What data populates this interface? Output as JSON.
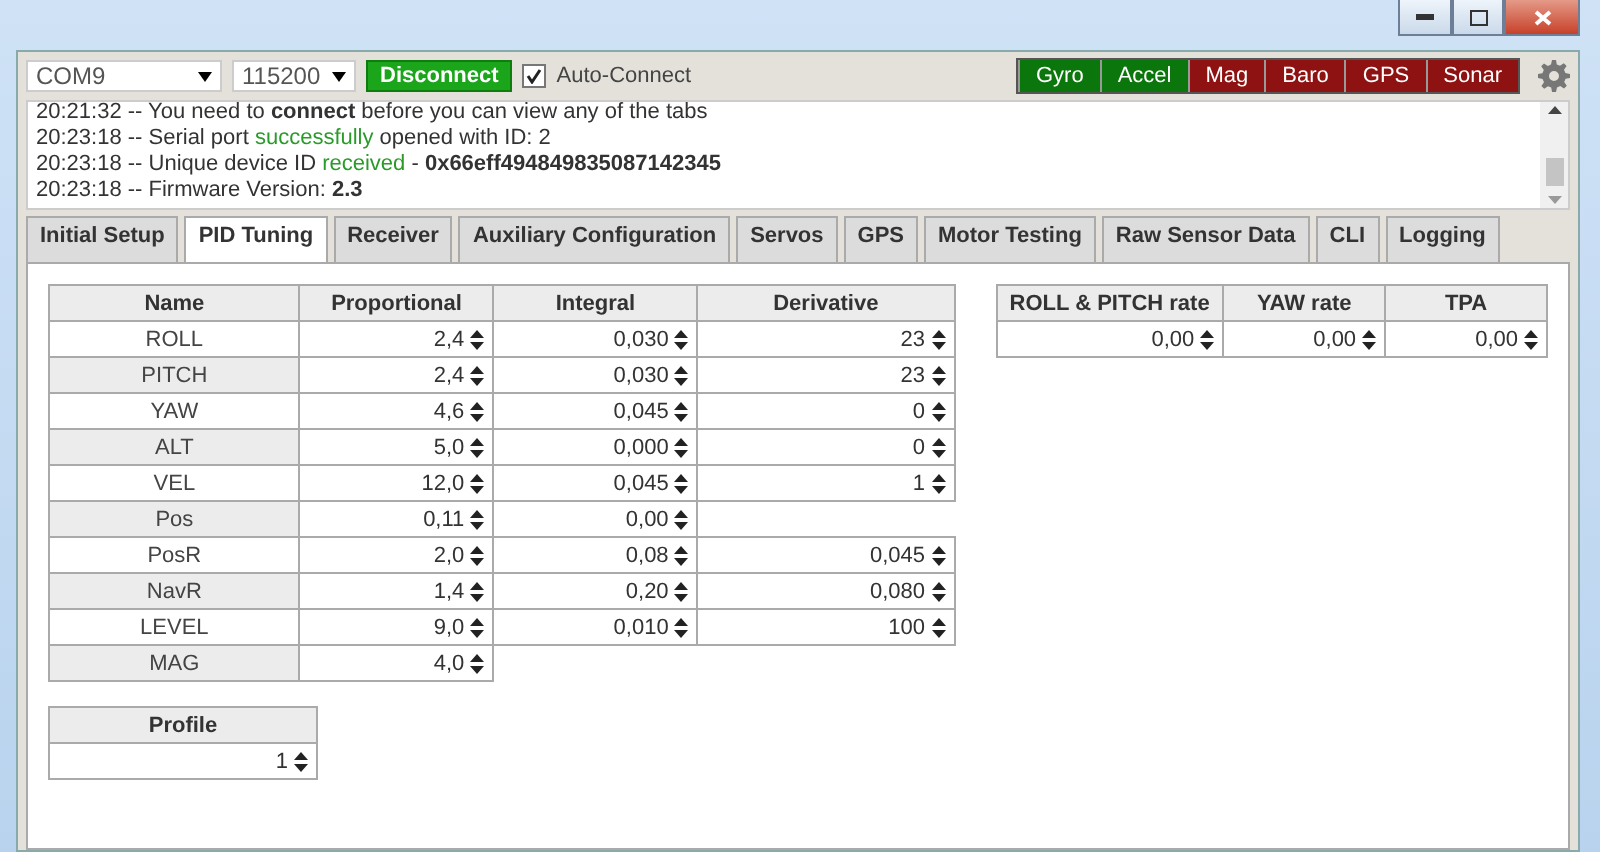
{
  "toolbar": {
    "port": "COM9",
    "baud": "115200",
    "connect_button": "Disconnect",
    "auto_connect": {
      "label": "Auto-Connect",
      "checked": true
    },
    "sensors": [
      {
        "label": "Gyro",
        "on": true
      },
      {
        "label": "Accel",
        "on": true
      },
      {
        "label": "Mag",
        "on": false
      },
      {
        "label": "Baro",
        "on": false
      },
      {
        "label": "GPS",
        "on": false
      },
      {
        "label": "Sonar",
        "on": false
      }
    ]
  },
  "log": [
    [
      {
        "text": "20:21:32 -- You need to ",
        "kind": "plain"
      },
      {
        "text": "connect",
        "kind": "bold"
      },
      {
        "text": " before you can view any of the tabs",
        "kind": "plain"
      }
    ],
    [
      {
        "text": "20:23:18 -- Serial port ",
        "kind": "plain"
      },
      {
        "text": "successfully",
        "kind": "green"
      },
      {
        "text": " opened with ID: 2",
        "kind": "plain"
      }
    ],
    [
      {
        "text": "20:23:18 -- Unique device ID ",
        "kind": "plain"
      },
      {
        "text": "received",
        "kind": "green"
      },
      {
        "text": " - ",
        "kind": "plain"
      },
      {
        "text": "0x66eff494849835087142345",
        "kind": "bold"
      }
    ],
    [
      {
        "text": "20:23:18 -- Firmware Version: ",
        "kind": "plain"
      },
      {
        "text": "2.3",
        "kind": "bold"
      }
    ]
  ],
  "tabs": [
    {
      "label": "Initial Setup",
      "selected": false
    },
    {
      "label": "PID Tuning",
      "selected": true
    },
    {
      "label": "Receiver",
      "selected": false
    },
    {
      "label": "Auxiliary Configuration",
      "selected": false
    },
    {
      "label": "Servos",
      "selected": false
    },
    {
      "label": "GPS",
      "selected": false
    },
    {
      "label": "Motor Testing",
      "selected": false
    },
    {
      "label": "Raw Sensor Data",
      "selected": false
    },
    {
      "label": "CLI",
      "selected": false
    },
    {
      "label": "Logging",
      "selected": false
    }
  ],
  "pid_table": {
    "columns": [
      "Name",
      "Proportional",
      "Integral",
      "Derivative"
    ],
    "rows": [
      {
        "name": "ROLL",
        "values": [
          "2,4",
          "0,030",
          "23"
        ]
      },
      {
        "name": "PITCH",
        "values": [
          "2,4",
          "0,030",
          "23"
        ]
      },
      {
        "name": "YAW",
        "values": [
          "4,6",
          "0,045",
          "0"
        ]
      },
      {
        "name": "ALT",
        "values": [
          "5,0",
          "0,000",
          "0"
        ]
      },
      {
        "name": "VEL",
        "values": [
          "12,0",
          "0,045",
          "1"
        ]
      },
      {
        "name": "Pos",
        "values": [
          "0,11",
          "0,00"
        ]
      },
      {
        "name": "PosR",
        "values": [
          "2,0",
          "0,08",
          "0,045"
        ]
      },
      {
        "name": "NavR",
        "values": [
          "1,4",
          "0,20",
          "0,080"
        ]
      },
      {
        "name": "LEVEL",
        "values": [
          "9,0",
          "0,010",
          "100"
        ]
      },
      {
        "name": "MAG",
        "values": [
          "4,0"
        ]
      }
    ]
  },
  "profile": {
    "label": "Profile",
    "value": "1"
  },
  "rate_table": {
    "columns": [
      "ROLL & PITCH rate",
      "YAW rate",
      "TPA"
    ],
    "values": [
      "0,00",
      "0,00",
      "0,00"
    ]
  }
}
